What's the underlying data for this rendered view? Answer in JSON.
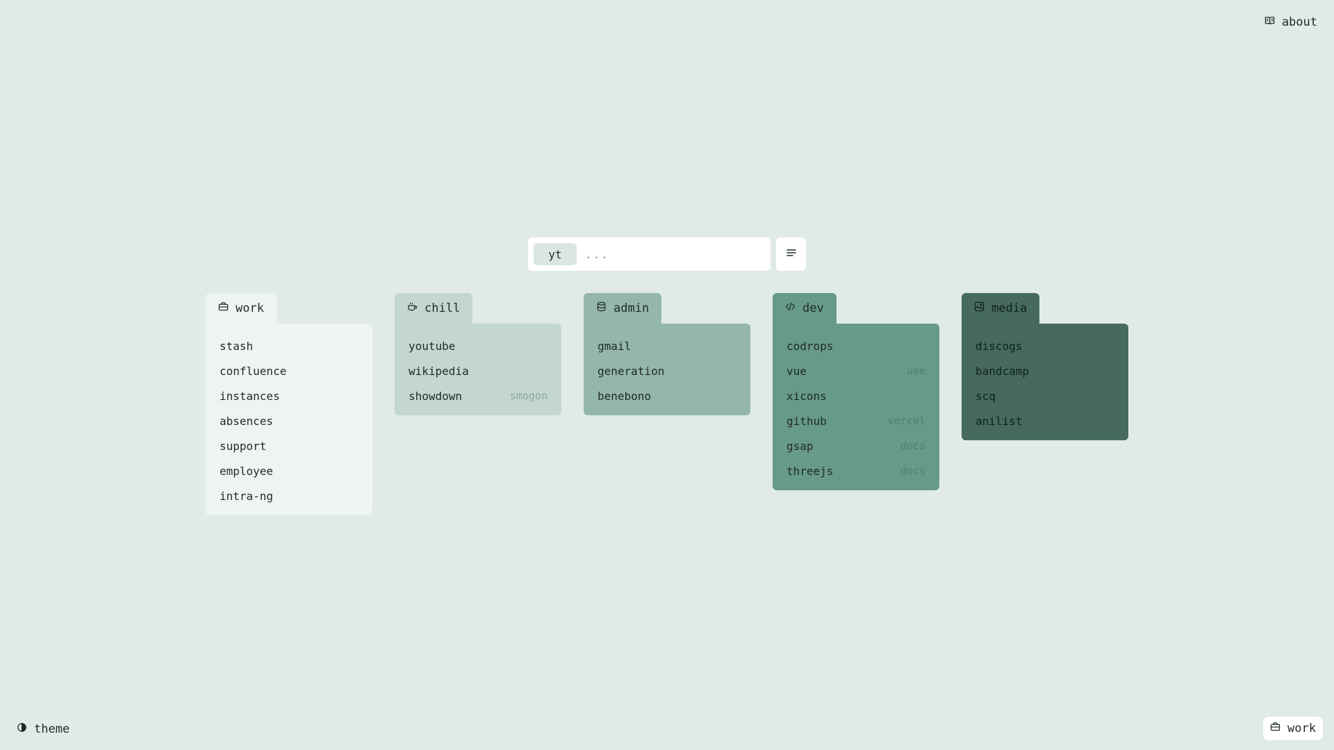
{
  "nav": {
    "about_label": "about",
    "theme_label": "theme",
    "current_page_label": "work"
  },
  "search": {
    "engine_tag": "yt",
    "placeholder": "..."
  },
  "icons": {
    "about": "book-open-icon",
    "theme": "contrast-icon",
    "menu": "menu-icon",
    "work": "briefcase-icon",
    "chill": "coffee-icon",
    "admin": "database-icon",
    "dev": "code-icon",
    "media": "image-icon"
  },
  "folders": [
    {
      "label": "work",
      "color": "#eef4f1",
      "links": [
        {
          "name": "stash",
          "tag": ""
        },
        {
          "name": "confluence",
          "tag": ""
        },
        {
          "name": "instances",
          "tag": ""
        },
        {
          "name": "absences",
          "tag": ""
        },
        {
          "name": "support",
          "tag": ""
        },
        {
          "name": "employee",
          "tag": ""
        },
        {
          "name": "intra-ng",
          "tag": ""
        }
      ]
    },
    {
      "label": "chill",
      "color": "#c4d7cf",
      "links": [
        {
          "name": "youtube",
          "tag": ""
        },
        {
          "name": "wikipedia",
          "tag": ""
        },
        {
          "name": "showdown",
          "tag": "smogon"
        }
      ]
    },
    {
      "label": "admin",
      "color": "#94b7a9",
      "links": [
        {
          "name": "gmail",
          "tag": ""
        },
        {
          "name": "generation",
          "tag": ""
        },
        {
          "name": "benebono",
          "tag": ""
        }
      ]
    },
    {
      "label": "dev",
      "color": "#679b87",
      "links": [
        {
          "name": "codrops",
          "tag": ""
        },
        {
          "name": "vue",
          "tag": "use"
        },
        {
          "name": "xicons",
          "tag": ""
        },
        {
          "name": "github",
          "tag": "vercel"
        },
        {
          "name": "gsap",
          "tag": "docs"
        },
        {
          "name": "threejs",
          "tag": "docs"
        }
      ]
    },
    {
      "label": "media",
      "color": "#466b5c",
      "links": [
        {
          "name": "discogs",
          "tag": ""
        },
        {
          "name": "bandcamp",
          "tag": ""
        },
        {
          "name": "scq",
          "tag": ""
        },
        {
          "name": "anilist",
          "tag": ""
        }
      ]
    }
  ]
}
